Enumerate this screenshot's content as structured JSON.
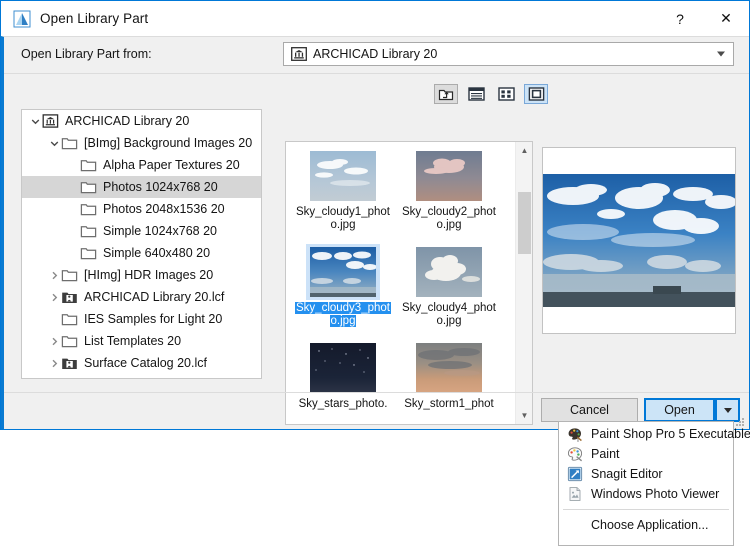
{
  "window": {
    "title": "Open Library Part",
    "app_icon": "archicad-icon",
    "help_button": "?",
    "close_button": "✕"
  },
  "source": {
    "label": "Open Library Part from:",
    "value": "ARCHICAD Library 20",
    "icon": "library-folder-icon",
    "dropdown_icon": "chevron-down-icon"
  },
  "view_toolbar": {
    "buttons": [
      {
        "name": "up-one-level-button",
        "icon": "folder-up-icon",
        "active": false
      },
      {
        "name": "list-view-button",
        "icon": "list-view-icon",
        "active": false
      },
      {
        "name": "details-view-button",
        "icon": "tiles-view-icon",
        "active": false
      },
      {
        "name": "large-icons-view-button",
        "icon": "large-icons-view-icon",
        "active": true
      }
    ]
  },
  "tree": {
    "items": [
      {
        "label": "ARCHICAD Library 20",
        "indent": 0,
        "chevron": "expanded",
        "icon": "library-folder-icon",
        "selected": false
      },
      {
        "label": "[BImg] Background Images 20",
        "indent": 1,
        "chevron": "expanded",
        "icon": "folder-icon",
        "selected": false
      },
      {
        "label": "Alpha Paper Textures 20",
        "indent": 2,
        "chevron": "none",
        "icon": "folder-icon",
        "selected": false
      },
      {
        "label": "Photos 1024x768 20",
        "indent": 2,
        "chevron": "none",
        "icon": "folder-icon",
        "selected": true
      },
      {
        "label": "Photos 2048x1536 20",
        "indent": 2,
        "chevron": "none",
        "icon": "folder-icon",
        "selected": false
      },
      {
        "label": "Simple 1024x768 20",
        "indent": 2,
        "chevron": "none",
        "icon": "folder-icon",
        "selected": false
      },
      {
        "label": "Simple 640x480 20",
        "indent": 2,
        "chevron": "none",
        "icon": "folder-icon",
        "selected": false
      },
      {
        "label": "[HImg] HDR Images 20",
        "indent": 1,
        "chevron": "collapsed",
        "icon": "folder-icon",
        "selected": false
      },
      {
        "label": "ARCHICAD Library 20.lcf",
        "indent": 1,
        "chevron": "collapsed",
        "icon": "lcf-archive-icon",
        "selected": false
      },
      {
        "label": "IES Samples for Light 20",
        "indent": 1,
        "chevron": "none",
        "icon": "folder-icon",
        "selected": false
      },
      {
        "label": "List Templates 20",
        "indent": 1,
        "chevron": "collapsed",
        "icon": "folder-icon",
        "selected": false
      },
      {
        "label": "Surface Catalog 20.lcf",
        "indent": 1,
        "chevron": "collapsed",
        "icon": "lcf-archive-icon",
        "selected": false
      }
    ]
  },
  "file_list": {
    "files": [
      {
        "name": "Sky_cloudy1_photo.jpg",
        "thumb": "sky-pale-blue-wisps",
        "selected": false
      },
      {
        "name": "Sky_cloudy2_photo.jpg",
        "thumb": "sky-dusk-pink-cloud",
        "selected": false
      },
      {
        "name": "Sky_cloudy3_photo.jpg",
        "thumb": "sky-deep-blue-clouds",
        "selected": true
      },
      {
        "name": "Sky_cloudy4_photo.jpg",
        "thumb": "sky-grey-cumulus",
        "selected": false
      },
      {
        "name": "Sky_stars_photo.",
        "thumb": "sky-night-stars",
        "selected": false
      },
      {
        "name": "Sky_storm1_phot",
        "thumb": "sky-storm-sunset",
        "selected": false
      }
    ],
    "scrollbar": {
      "up_icon": "chevron-up-icon",
      "down_icon": "chevron-down-icon"
    }
  },
  "preview": {
    "image": "sky-deep-blue-clouds-large",
    "alt": "Sky_cloudy3_photo.jpg preview"
  },
  "buttons": {
    "cancel": "Cancel",
    "open": "Open",
    "open_split_icon": "chevron-down-icon"
  },
  "context_menu": {
    "items": [
      {
        "label": "Paint Shop Pro 5 Executable",
        "icon": "paint-shop-pro-icon"
      },
      {
        "label": "Paint",
        "icon": "paint-icon"
      },
      {
        "label": "Snagit Editor",
        "icon": "snagit-icon"
      },
      {
        "label": "Windows Photo Viewer",
        "icon": "photo-viewer-icon"
      },
      {
        "separator": true
      },
      {
        "label": "Choose Application...",
        "icon": null
      }
    ]
  },
  "colors": {
    "accent": "#0078d7",
    "selection_blue": "#2490ef",
    "selection_light": "#cce2f8",
    "tree_selection": "#d6d6d6",
    "dialog_bg": "#f0f0f0"
  }
}
